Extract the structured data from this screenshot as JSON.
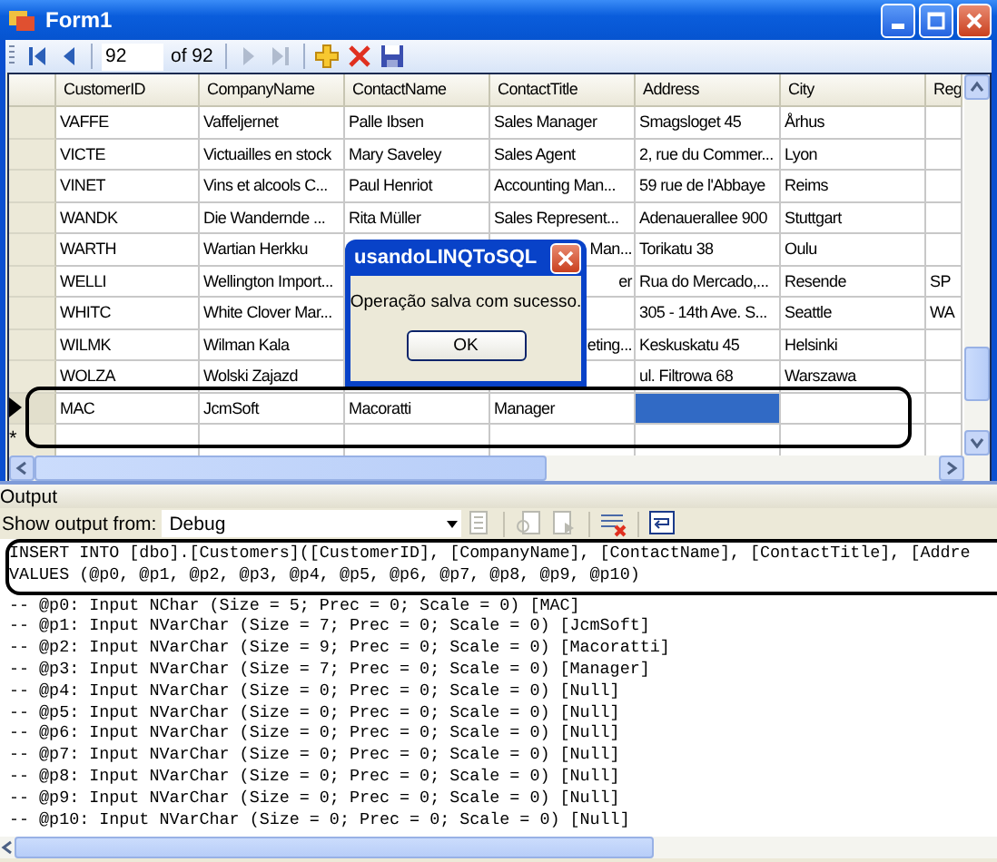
{
  "window": {
    "title": "Form1"
  },
  "toolbar": {
    "items": [
      {
        "kind": "first",
        "disabled": false
      },
      {
        "kind": "prev",
        "disabled": false
      },
      {
        "kind": "separator"
      },
      {
        "kind": "position",
        "value": "92"
      },
      {
        "kind": "total",
        "text": "of 92"
      },
      {
        "kind": "separator"
      },
      {
        "kind": "next",
        "disabled": true
      },
      {
        "kind": "last",
        "disabled": true
      },
      {
        "kind": "separator"
      },
      {
        "kind": "add",
        "disabled": false
      },
      {
        "kind": "delete",
        "disabled": false
      },
      {
        "kind": "save",
        "disabled": false
      }
    ]
  },
  "grid": {
    "columns": [
      "CustomerID",
      "CompanyName",
      "ContactName",
      "ContactTitle",
      "Address",
      "City",
      "Reg"
    ],
    "rows": [
      {
        "kind": "data",
        "current": false,
        "cells": [
          "VAFFE",
          "Vaffeljernet",
          "Palle Ibsen",
          "Sales Manager",
          "Smagsloget 45",
          "Århus",
          null
        ]
      },
      {
        "kind": "data",
        "current": false,
        "cells": [
          "VICTE",
          "Victuailles en stock",
          "Mary Saveley",
          "Sales Agent",
          "2, rue du Commer...",
          "Lyon",
          null
        ]
      },
      {
        "kind": "data",
        "current": false,
        "cells": [
          "VINET",
          "Vins et alcools C...",
          "Paul Henriot",
          "Accounting Man...",
          "59 rue de l'Abbaye",
          "Reims",
          null
        ]
      },
      {
        "kind": "data",
        "current": false,
        "cells": [
          "WANDK",
          "Die Wandernde ...",
          "Rita Müller",
          "Sales Represent...",
          "Adenauerallee 900",
          "Stuttgart",
          null
        ]
      },
      {
        "kind": "data",
        "current": false,
        "cells": [
          "WARTH",
          "Wartian Herkku",
          null,
          "Man...",
          "Torikatu 38",
          "Oulu",
          null
        ]
      },
      {
        "kind": "data",
        "current": false,
        "cells": [
          "WELLI",
          "Wellington Import...",
          null,
          "er",
          "Rua do Mercado,...",
          "Resende",
          "SP"
        ]
      },
      {
        "kind": "data",
        "current": false,
        "cells": [
          "WHITC",
          "White Clover Mar...",
          null,
          null,
          "305 - 14th Ave. S...",
          "Seattle",
          "WA"
        ]
      },
      {
        "kind": "data",
        "current": false,
        "cells": [
          "WILMK",
          "Wilman Kala",
          null,
          "eting...",
          "Keskuskatu 45",
          "Helsinki",
          null
        ]
      },
      {
        "kind": "data",
        "current": false,
        "cells": [
          "WOLZA",
          "Wolski  Zajazd",
          null,
          null,
          "ul. Filtrowa 68",
          "Warszawa",
          null
        ]
      },
      {
        "kind": "data",
        "current": true,
        "cells": [
          "MAC",
          "JcmSoft",
          "Macoratti",
          "Manager",
          {
            "selected": true
          },
          null,
          null
        ]
      },
      {
        "kind": "new",
        "marker": "*",
        "current": false,
        "cells": [
          null,
          null,
          null,
          null,
          null,
          null,
          null
        ]
      }
    ]
  },
  "dialog": {
    "title": "usandoLINQToSQL",
    "message": "Operação salva com sucesso.",
    "button": "OK"
  },
  "output": {
    "title": "Output",
    "source_label": "Show output from:",
    "source": "Debug",
    "tools": [
      {
        "kind": "goto",
        "disabled": true
      },
      {
        "kind": "separator"
      },
      {
        "kind": "find-prev",
        "disabled": true
      },
      {
        "kind": "find-next",
        "disabled": true
      },
      {
        "kind": "separator"
      },
      {
        "kind": "clear",
        "disabled": false
      },
      {
        "kind": "separator"
      },
      {
        "kind": "wrap",
        "disabled": false
      }
    ],
    "lines": [
      "INSERT INTO [dbo].[Customers]([CustomerID], [CompanyName], [ContactName], [ContactTitle], [Addre",
      "VALUES (@p0, @p1, @p2, @p3, @p4, @p5, @p6, @p7, @p8, @p9, @p10)",
      "-- @p0: Input NChar (Size = 5; Prec = 0; Scale = 0) [MAC]",
      "-- @p1: Input NVarChar (Size = 7; Prec = 0; Scale = 0) [JcmSoft]",
      "-- @p2: Input NVarChar (Size = 9; Prec = 0; Scale = 0) [Macoratti]",
      "-- @p3: Input NVarChar (Size = 7; Prec = 0; Scale = 0) [Manager]",
      "-- @p4: Input NVarChar (Size = 0; Prec = 0; Scale = 0) [Null]",
      "-- @p5: Input NVarChar (Size = 0; Prec = 0; Scale = 0) [Null]",
      "-- @p6: Input NVarChar (Size = 0; Prec = 0; Scale = 0) [Null]",
      "-- @p7: Input NVarChar (Size = 0; Prec = 0; Scale = 0) [Null]",
      "-- @p8: Input NVarChar (Size = 0; Prec = 0; Scale = 0) [Null]",
      "-- @p9: Input NVarChar (Size = 0; Prec = 0; Scale = 0) [Null]",
      "-- @p10: Input NVarChar (Size = 0; Prec = 0; Scale = 0) [Null]"
    ]
  }
}
